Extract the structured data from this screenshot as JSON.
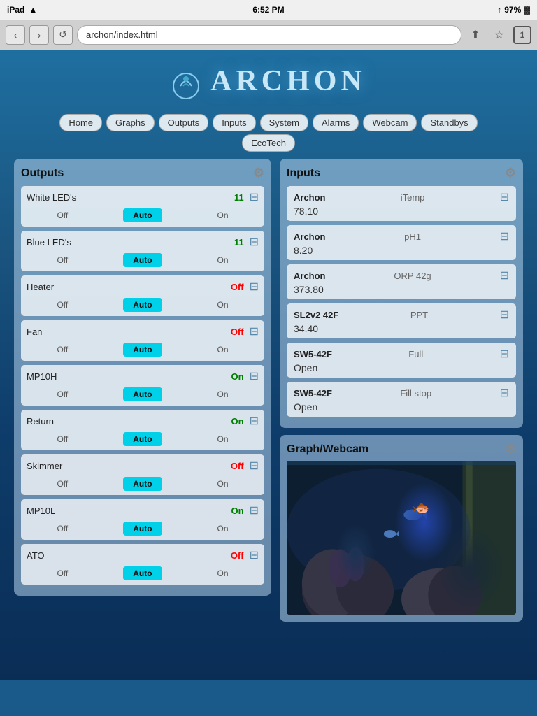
{
  "statusBar": {
    "carrier": "iPad",
    "wifi": "WiFi",
    "time": "6:52 PM",
    "signal": "↑",
    "battery": "97%"
  },
  "browser": {
    "url": "archon/index.html",
    "tabCount": "1"
  },
  "logo": {
    "text": "ARCHON"
  },
  "nav": {
    "items": [
      "Home",
      "Graphs",
      "Outputs",
      "Inputs",
      "System",
      "Alarms",
      "Webcam",
      "Standbys"
    ],
    "secondRow": [
      "EcoTech"
    ]
  },
  "outputs": {
    "title": "Outputs",
    "gear": "⚙",
    "items": [
      {
        "name": "White LED's",
        "status": "11",
        "statusType": "num",
        "controls": [
          "Off",
          "Auto",
          "On"
        ]
      },
      {
        "name": "Blue LED's",
        "status": "11",
        "statusType": "num",
        "controls": [
          "Off",
          "Auto",
          "On"
        ]
      },
      {
        "name": "Heater",
        "status": "Off",
        "statusType": "off",
        "controls": [
          "Off",
          "Auto",
          "On"
        ]
      },
      {
        "name": "Fan",
        "status": "Off",
        "statusType": "off",
        "controls": [
          "Off",
          "Auto",
          "On"
        ]
      },
      {
        "name": "MP10H",
        "status": "On",
        "statusType": "on",
        "controls": [
          "Off",
          "Auto",
          "On"
        ]
      },
      {
        "name": "Return",
        "status": "On",
        "statusType": "on",
        "controls": [
          "Off",
          "Auto",
          "On"
        ]
      },
      {
        "name": "Skimmer",
        "status": "Off",
        "statusType": "off",
        "controls": [
          "Off",
          "Auto",
          "On"
        ]
      },
      {
        "name": "MP10L",
        "status": "On",
        "statusType": "on",
        "controls": [
          "Off",
          "Auto",
          "On"
        ]
      },
      {
        "name": "ATO",
        "status": "Off",
        "statusType": "off",
        "controls": [
          "Off",
          "Auto",
          "On"
        ]
      }
    ]
  },
  "inputs": {
    "title": "Inputs",
    "gear": "⚙",
    "items": [
      {
        "source": "Archon",
        "type": "iTemp",
        "value": "78.10"
      },
      {
        "source": "Archon",
        "type": "pH1",
        "value": "8.20"
      },
      {
        "source": "Archon",
        "type": "ORP 42g",
        "value": "373.80"
      },
      {
        "source": "SL2v2 42F",
        "type": "PPT",
        "value": "34.40"
      },
      {
        "source": "SW5-42F",
        "type": "Full",
        "value": "Open"
      },
      {
        "source": "SW5-42F",
        "type": "Fill stop",
        "value": "Open"
      }
    ]
  },
  "graphWebcam": {
    "title": "Graph/Webcam",
    "gear": "⚙"
  },
  "tuneIcon": "⊞",
  "icons": {
    "tune": "≡|"
  }
}
